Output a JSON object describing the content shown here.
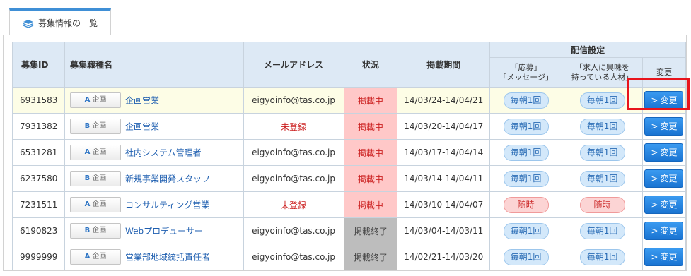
{
  "tab": {
    "label": "募集情報の一覧",
    "icon": "stack-icon"
  },
  "table": {
    "headers": {
      "id": "募集ID",
      "name": "募集職種名",
      "mail": "メールアドレス",
      "status": "状況",
      "period": "掲載期間",
      "delivery": "配信設定",
      "apply_line1": "「応募」",
      "apply_line2": "「メッセージ」",
      "interest_line1": "「求人に興味を",
      "interest_line2": "持っている人材」",
      "change": "変更"
    },
    "button_label": "変更",
    "rows": [
      {
        "id": "6931583",
        "tag_letter": "A",
        "tag_text": "企画",
        "name": "企画営業",
        "mail": "eigyoinfo@tas.co.jp",
        "status": "掲載中",
        "status_type": "live",
        "period": "14/03/24-14/04/21",
        "apply": "毎朝1回",
        "apply_type": "blue",
        "interest": "毎朝1回",
        "interest_type": "blue",
        "highlight": true
      },
      {
        "id": "7931382",
        "tag_letter": "B",
        "tag_text": "企画",
        "name": "企画営業",
        "mail": "未登録",
        "mail_unreg": true,
        "status": "掲載中",
        "status_type": "live",
        "period": "14/03/20-14/04/17",
        "apply": "毎朝1回",
        "apply_type": "blue",
        "interest": "毎朝1回",
        "interest_type": "blue"
      },
      {
        "id": "6531281",
        "tag_letter": "A",
        "tag_text": "企画",
        "name": "社内システム管理者",
        "mail": "eigyoinfo@tas.co.jp",
        "status": "掲載中",
        "status_type": "live",
        "period": "14/03/17-14/04/14",
        "apply": "毎朝1回",
        "apply_type": "blue",
        "interest": "毎朝1回",
        "interest_type": "blue"
      },
      {
        "id": "6237580",
        "tag_letter": "B",
        "tag_text": "企画",
        "name": "新規事業開発スタッフ",
        "mail": "eigyoinfo@tas.co.jp",
        "status": "掲載中",
        "status_type": "live",
        "period": "14/03/14-14/04/11",
        "apply": "毎朝1回",
        "apply_type": "blue",
        "interest": "毎朝1回",
        "interest_type": "blue"
      },
      {
        "id": "7231511",
        "tag_letter": "A",
        "tag_text": "企画",
        "name": "コンサルティング営業",
        "mail": "未登録",
        "mail_unreg": true,
        "status": "掲載中",
        "status_type": "live",
        "period": "14/03/10-14/04/07",
        "apply": "随時",
        "apply_type": "red",
        "interest": "随時",
        "interest_type": "red"
      },
      {
        "id": "6190823",
        "tag_letter": "B",
        "tag_text": "企画",
        "name": "Webプロデューサー",
        "mail": "eigyoinfo@tas.co.jp",
        "status": "掲載終了",
        "status_type": "end",
        "period": "14/03/04-14/03/11",
        "apply": "毎朝1回",
        "apply_type": "blue",
        "interest": "毎朝1回",
        "interest_type": "blue"
      },
      {
        "id": "9999999",
        "tag_letter": "A",
        "tag_text": "企画",
        "name": "営業部地域統括責任者",
        "mail": "eigyoinfo@tas.co.jp",
        "status": "掲載終了",
        "status_type": "end",
        "period": "14/02/21-14/03/20",
        "apply": "毎朝1回",
        "apply_type": "blue",
        "interest": "毎朝1回",
        "interest_type": "blue"
      }
    ]
  },
  "colors": {
    "accent": "#3f8fd6",
    "button": "#1a74d2",
    "highlight_border": "#e8141c",
    "live_bg": "#ffc8c8",
    "end_bg": "#bdbdbd"
  }
}
